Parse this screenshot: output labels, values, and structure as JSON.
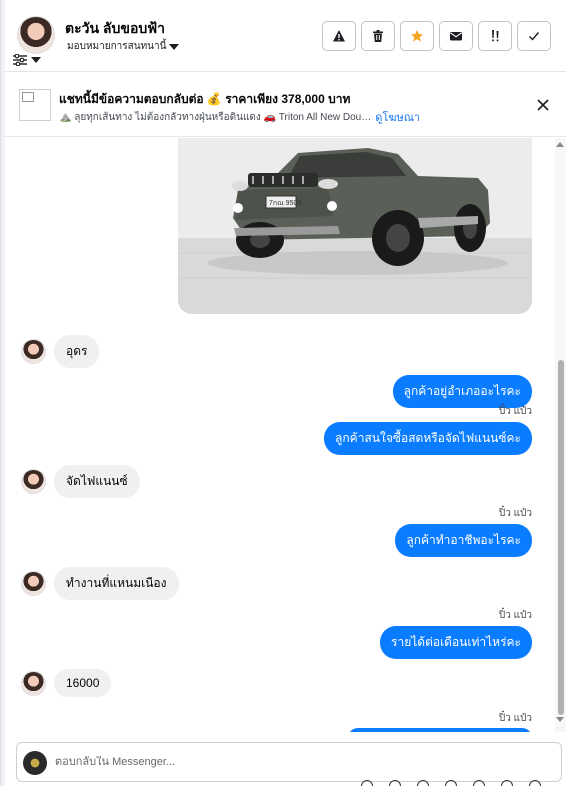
{
  "header": {
    "user_name": "ตะวัน ลับขอบฟ้า",
    "assign_label": "มอบหมายการสนทนานี้",
    "buttons": [
      {
        "icon": "warning-icon"
      },
      {
        "icon": "trash-icon"
      },
      {
        "icon": "star-icon",
        "color": "#f5a623"
      },
      {
        "icon": "mail-icon"
      },
      {
        "icon": "mark-important-icon"
      },
      {
        "icon": "check-icon"
      }
    ]
  },
  "ad": {
    "title": "แชทนี้มีข้อความตอบกลับต่อ 💰 ราคาเพียง 378,000 บาท",
    "sub_text": "⛰️ ลุยทุกเส้นทาง ไม่ต้องกลัวทางฝุ่นหรือดินแดง 🚗 Triton All New Dou…",
    "link": "ดูโฆษณา"
  },
  "messages": [
    {
      "dir": "in",
      "text": "อุดร"
    },
    {
      "dir": "out",
      "text": "ลูกค้าอยู่อำเภออะไรคะ"
    },
    {
      "dir": "out",
      "text": "ลูกค้าสนใจซื้อสดหรือจัดไฟแนนซ์คะ",
      "read": "ปิ๋ว แป๋ว"
    },
    {
      "dir": "in",
      "text": "จัดไฟแนนซ์"
    },
    {
      "dir": "out",
      "text": "ลูกค้าทำอาชีพอะไรคะ",
      "read": "ปิ๋ว แป๋ว"
    },
    {
      "dir": "in",
      "text": "ทำงานที่แหนมเนือง"
    },
    {
      "dir": "out",
      "text": "รายได้ต่อเดือนเท่าไหร่คะ",
      "read": "ปิ๋ว แป๋ว"
    },
    {
      "dir": "in",
      "text": "16000"
    }
  ],
  "read_last": "ปิ๋ว แป๋ว",
  "photo": {
    "plate": "7กณ 9509"
  },
  "composer": {
    "placeholder": "ตอบกลับใน Messenger..."
  },
  "colors": {
    "outgoing_bubble": "#0a7cff",
    "incoming_bubble": "#f0f0f0",
    "link": "#1877f2"
  }
}
